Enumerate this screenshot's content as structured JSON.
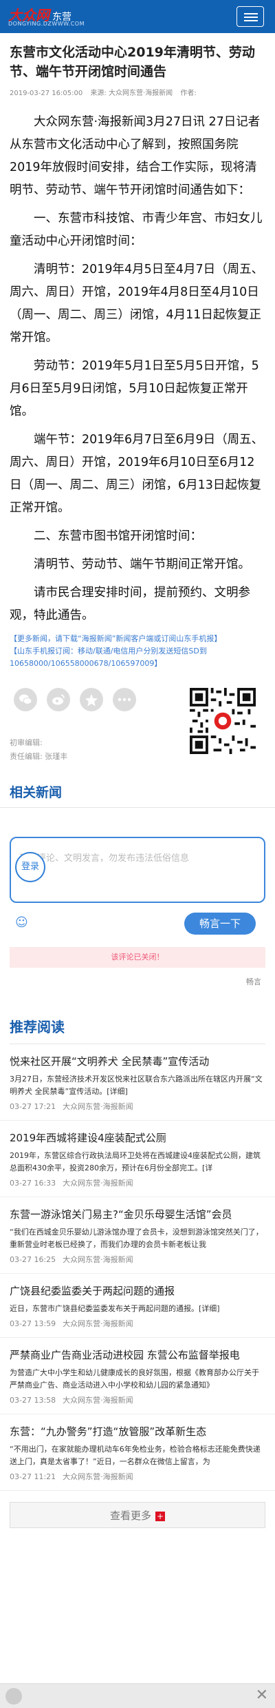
{
  "header": {
    "logo_text": "大众网",
    "site_name": "东营",
    "logo_domain": "DONGYING.DZWWW.COM"
  },
  "article": {
    "title": "东营市文化活动中心2019年清明节、劳动节、端午节开闭馆时间通告",
    "date": "2019-03-27 16:05:00",
    "source": "来源: 大众网东营·海报新闻",
    "author": "作者:",
    "paragraphs": [
      "大众网东营·海报新闻3月27日讯 27日记者从东营市文化活动中心了解到，按照国务院2019年放假时间安排，结合工作实际，现将清明节、劳动节、端午节开闭馆时间通告如下：",
      "一、东营市科技馆、市青少年宫、市妇女儿童活动中心开闭馆时间：",
      "清明节：2019年4月5日至4月7日（周五、周六、周日）开馆，2019年4月8日至4月10日（周一、周二、周三）闭馆，4月11日起恢复正常开馆。",
      "劳动节：2019年5月1日至5月5日开馆，5月6日至5月9日闭馆，5月10日起恢复正常开馆。",
      "端午节：2019年6月7日至6月9日（周五、周六、周日）开馆，2019年6月10日至6月12日（周一、周二、周三）闭馆，6月13日起恢复正常开馆。",
      "二、东营市图书馆开闭馆时间：",
      "清明节、劳动节、端午节期间正常开馆。",
      "请市民合理安排时间，提前预约、文明参观，特此通告。"
    ],
    "note_line1": "【更多新闻，请下载“海报新闻”新闻客户端或订阅山东手机报】",
    "note_line2": "【山东手机报订阅：移动/联通/电信用户分别发送短信SD到10658000/106558000678/106597009】",
    "editor_first": "初审编辑:",
    "editor_resp": "责任编辑: 张瑾丰"
  },
  "share_icons": [
    "wechat-icon",
    "weibo-icon",
    "favorite-icon",
    "more-icon"
  ],
  "related": {
    "heading": "相关新闻"
  },
  "comment": {
    "login_label": "登录",
    "placeholder": "理性评论、文明发言，勿发布违法低俗信息",
    "submit_label": "畅言一下",
    "closed_text": "该评论已关闭！",
    "brand": "畅言"
  },
  "recommend": {
    "heading": "推荐阅读",
    "items": [
      {
        "title": "悦来社区开展“文明养犬 全民禁毒”宣传活动",
        "desc": "3月27日，东营经济技术开发区悦来社区联合东六路派出所在辖区内开展“文明养犬 全民禁毒”宣传活动。",
        "detail": "[详细]",
        "date": "03-27 17:21",
        "source": "大众网东营·海报新闻"
      },
      {
        "title": "2019年西城将建设4座装配式公厕",
        "desc": "2019年，东营区综合行政执法局环卫处将在西城建设4座装配式公厕，建筑总面积430余平，投资280余万，预计在6月份全部完工。",
        "detail": "[详",
        "date": "03-27 16:33",
        "source": "大众网东营·海报新闻"
      },
      {
        "title": "东营一游泳馆关门易主?“金贝乐母婴生活馆”会员",
        "desc": "“我们在西城金贝乐婴幼儿游泳馆办理了会员卡，没想到游泳馆突然关门了，重新营业时老板已经换了，而我们办理的会员卡新老板让我",
        "detail": "",
        "date": "03-27 16:25",
        "source": "大众网东营·海报新闻"
      },
      {
        "title": "广饶县纪委监委关于两起问题的通报",
        "desc": "近日，东营市广饶县纪委监委发布关于两起问题的通报。",
        "detail": "[详细]",
        "date": "03-27 13:59",
        "source": "大众网东营·海报新闻"
      },
      {
        "title": "严禁商业广告商业活动进校园 东营公布监督举报电",
        "desc": "为营造广大中小学生和幼儿健康成长的良好氛围，根据《教育部办公厅关于严禁商业广告、商业活动进入中小学校和幼儿园的紧急通知》",
        "detail": "",
        "date": "03-27 13:58",
        "source": "大众网东营·海报新闻"
      },
      {
        "title": "东营：“九办警务”打造“放管服”改革新生态",
        "desc": "“不用出门，在家就能办理机动车6年免检业务，检验合格标志还能免费快递送上门，真是太省事了！”近日，一名群众在微信上留言，为",
        "detail": "",
        "date": "03-27 11:21",
        "source": "大众网东营·海报新闻"
      }
    ],
    "more_label": "查看更多",
    "more_plus": "+"
  },
  "colors": {
    "header_bg": "#1262b3",
    "accent_blue": "#1a5fad",
    "logo_red": "#e12020"
  }
}
